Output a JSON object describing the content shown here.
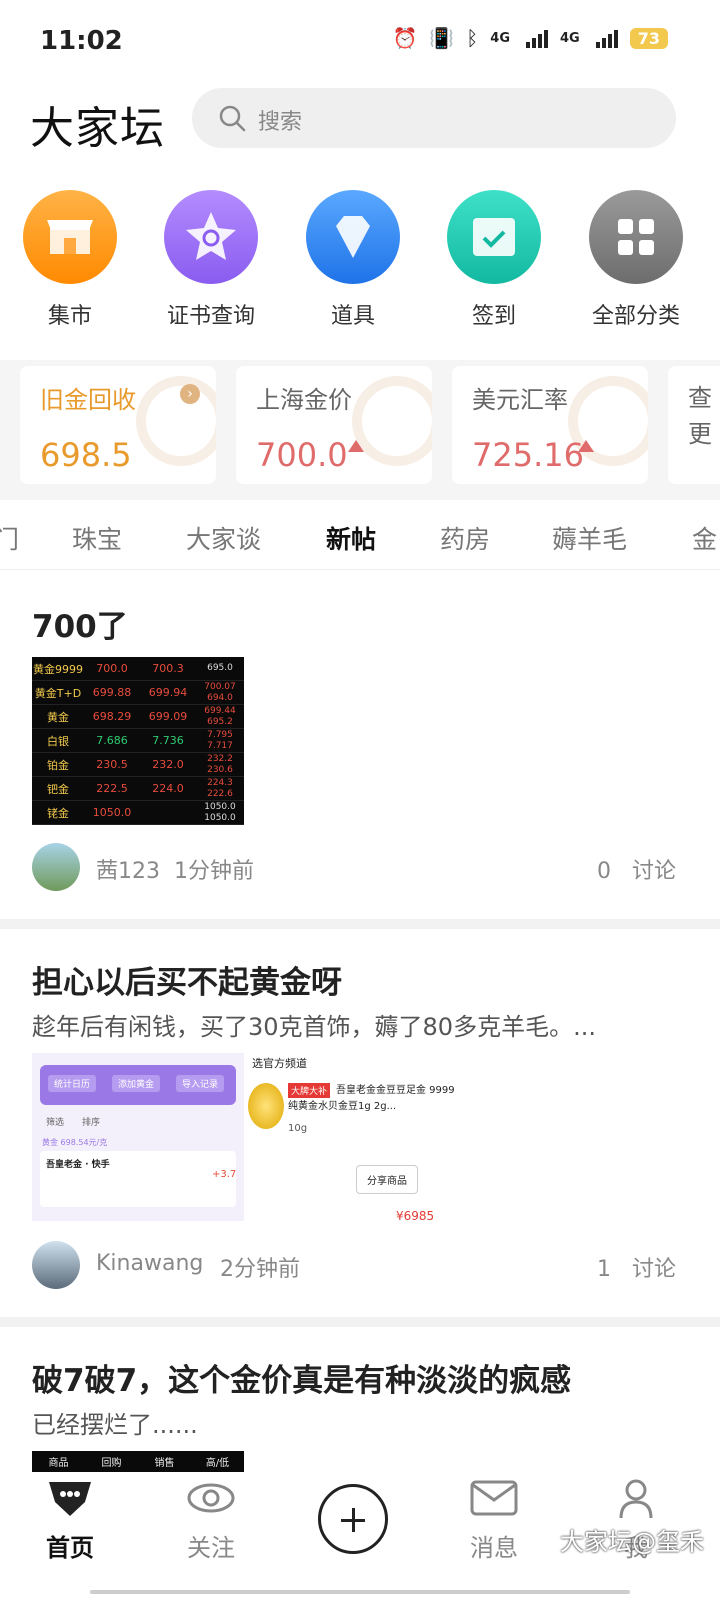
{
  "status": {
    "time": "11:02",
    "net1": "4G",
    "net2": "4G",
    "battery": "73"
  },
  "header": {
    "logo": "大家坛",
    "search_placeholder": "搜索"
  },
  "quick": [
    {
      "label": "集市",
      "icon": "store-icon",
      "color": "#ff9800"
    },
    {
      "label": "证书查询",
      "icon": "certificate-search-icon",
      "color": "#9c6cf0"
    },
    {
      "label": "道具",
      "icon": "diamond-icon",
      "color": "#2f86f6"
    },
    {
      "label": "签到",
      "icon": "calendar-check-icon",
      "color": "#1fc9b4"
    },
    {
      "label": "全部分类",
      "icon": "grid-icon",
      "color": "#7d7d7d"
    }
  ],
  "cards": [
    {
      "title": "旧金回收",
      "value": "698.5",
      "color": "#e89a2c"
    },
    {
      "title": "上海金价",
      "value": "700.0",
      "color": "#e06b6b"
    },
    {
      "title": "美元汇率",
      "value": "725.16",
      "color": "#e06b6b"
    },
    {
      "title": "查更",
      "value": ""
    }
  ],
  "tabs": [
    "门",
    "珠宝",
    "大家谈",
    "新帖",
    "药房",
    "薅羊毛",
    "金"
  ],
  "posts": [
    {
      "title": "700了",
      "user": "茜123",
      "time": "1分钟前",
      "count": "0",
      "count_label": "讨论",
      "table": [
        [
          "黄金9999",
          "700.0",
          "700.3",
          "695.0"
        ],
        [
          "黄金T+D",
          "699.88",
          "699.94",
          "700.07 694.0"
        ],
        [
          "黄金",
          "698.29",
          "699.09",
          "699.44 695.2"
        ],
        [
          "白银",
          "7.686",
          "7.736",
          "7.795 7.717"
        ],
        [
          "铂金",
          "230.5",
          "232.0",
          "232.2 230.6"
        ],
        [
          "钯金",
          "222.5",
          "224.0",
          "224.3 222.6"
        ],
        [
          "铑金",
          "1050.0",
          "",
          "1050.0 1050.0"
        ]
      ]
    },
    {
      "title": "担心以后买不起黄金呀",
      "desc": "趁年后有闲钱，买了30克首饰，薅了80多克羊毛。...",
      "user": "Kinawang",
      "time": "2分钟前",
      "count": "1",
      "count_label": "讨论",
      "shot": {
        "btn1": "统计日历",
        "btn2": "添加黄金",
        "btn3": "导入记录",
        "filter": "筛选",
        "sort": "排序",
        "row_price": "黄金  698.54元/克",
        "row_title": "吾皇老金 · 快手",
        "gain": "+3.7",
        "banner": "选官方频道",
        "tag": "大牌大补",
        "product": "吾皇老金金豆豆足金 9999纯黄金水贝金豆1g 2g...",
        "weight": "10g",
        "share": "分享商品",
        "price": "¥6985"
      }
    },
    {
      "title": "破7破7，这个金价真是有种淡淡的疯感",
      "desc": "已经摆烂了......",
      "thumb_headers": [
        "商品",
        "回购",
        "销售",
        "高/低"
      ]
    }
  ],
  "nav": [
    {
      "label": "首页",
      "icon": "home-icon"
    },
    {
      "label": "关注",
      "icon": "eye-icon"
    },
    {
      "label": "",
      "icon": "plus-icon"
    },
    {
      "label": "消息",
      "icon": "mail-icon"
    },
    {
      "label": "我",
      "icon": "user-icon"
    }
  ],
  "watermark": "大家坛@玺禾"
}
